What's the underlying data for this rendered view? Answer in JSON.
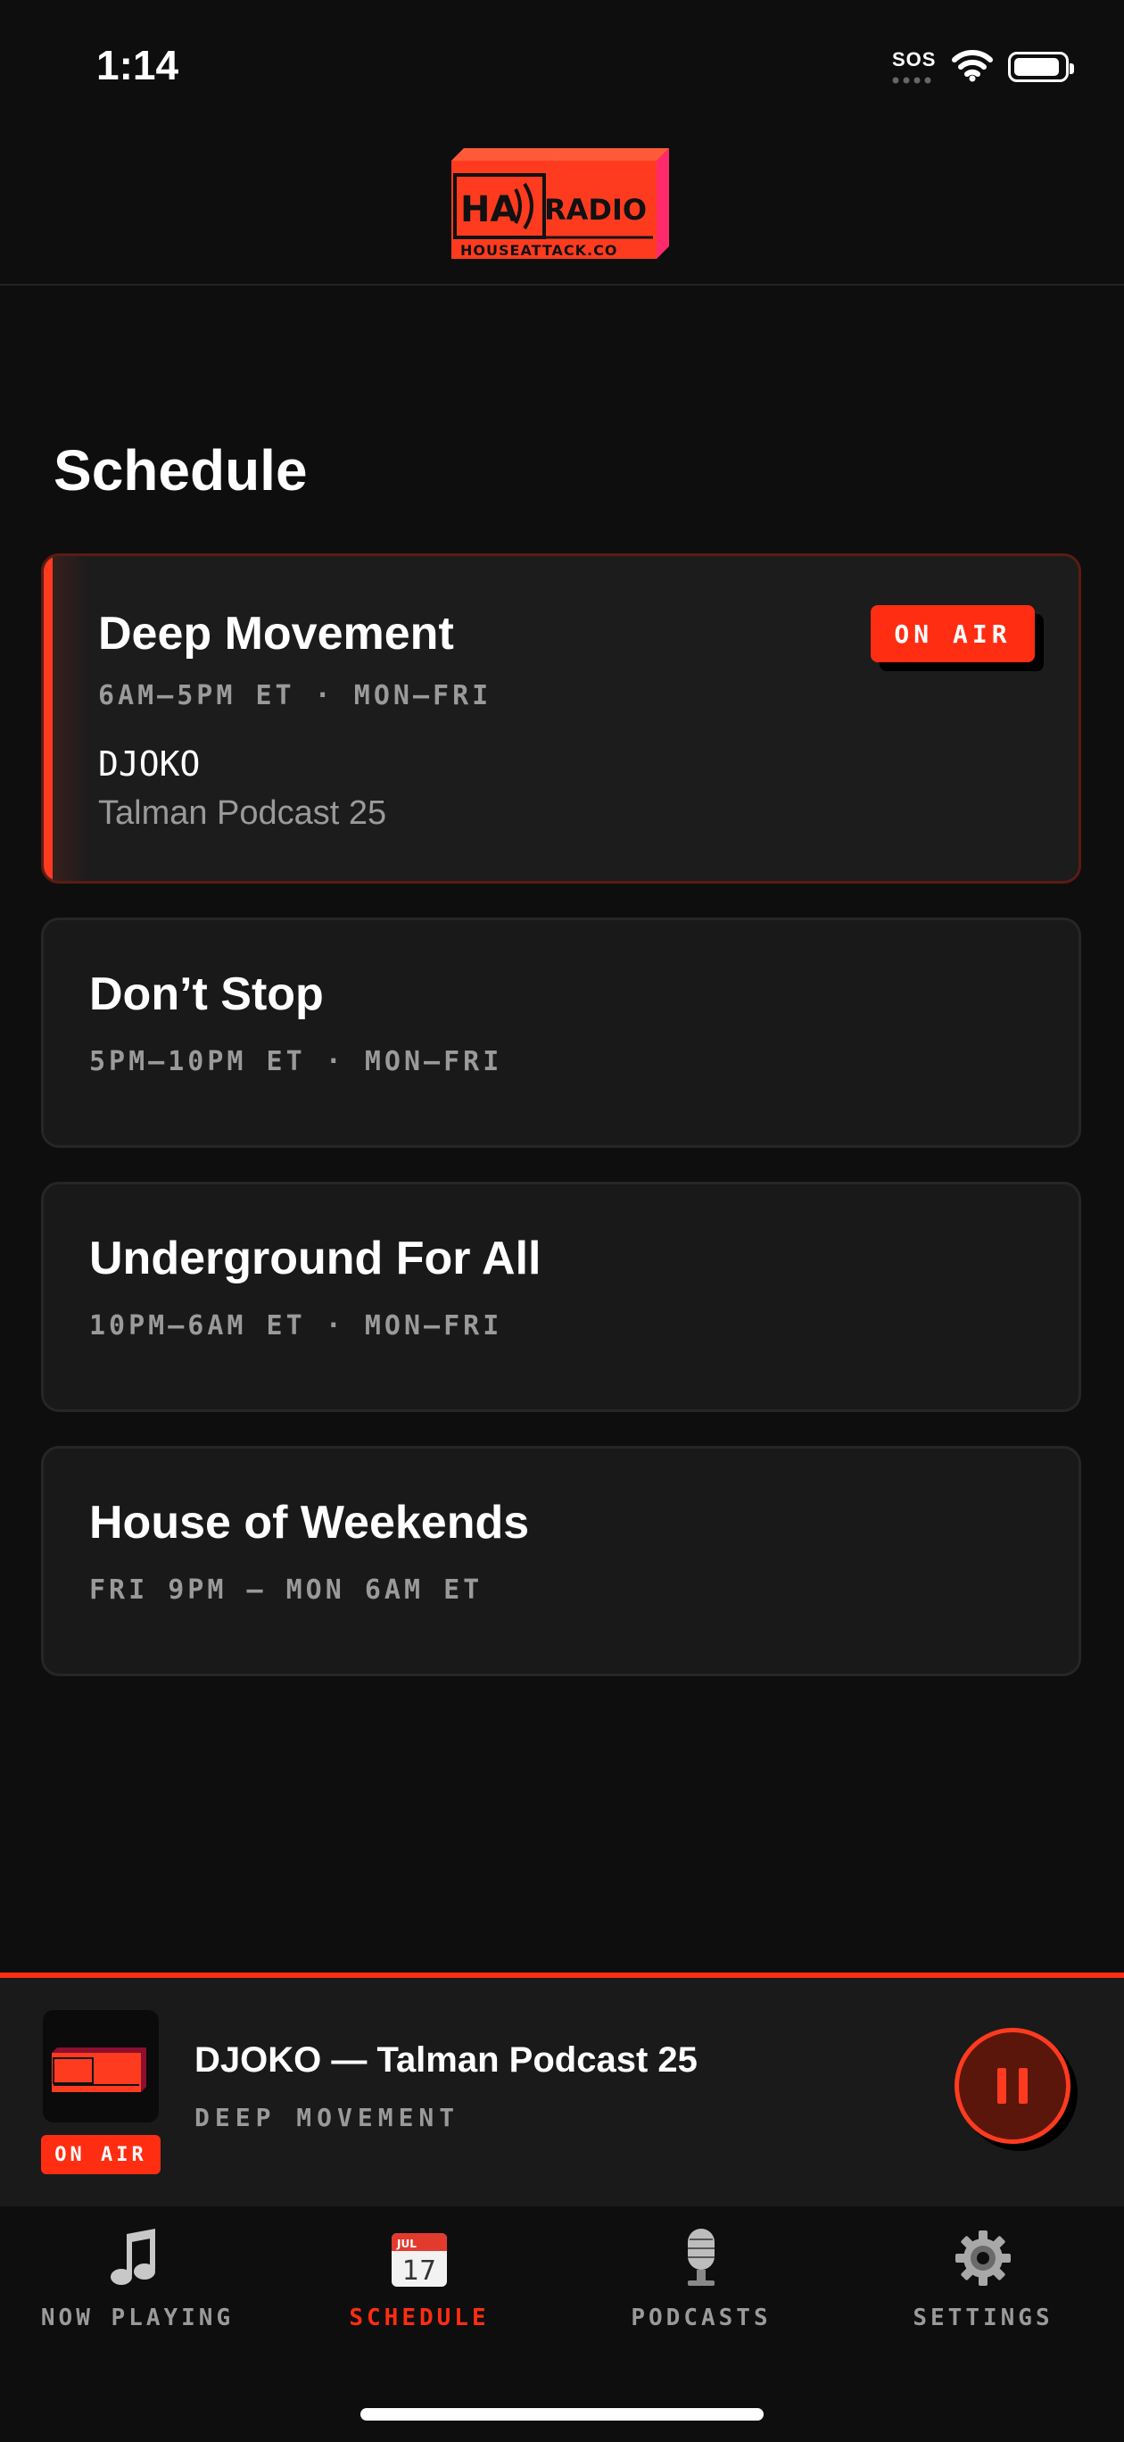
{
  "status_bar": {
    "time": "1:14",
    "sos": "SOS"
  },
  "header": {
    "logo_word": "RADIO",
    "logo_sub": "HOUSEATTACK.CO",
    "logo_mark": "HA"
  },
  "page": {
    "title": "Schedule"
  },
  "schedule": [
    {
      "title": "Deep Movement",
      "time": "6AM–5PM ET · MON–FRI",
      "dj": "DJOKO",
      "track": "Talman Podcast 25",
      "badge": "ON AIR"
    },
    {
      "title": "Don’t Stop",
      "time": "5PM–10PM ET · MON–FRI"
    },
    {
      "title": "Underground For All",
      "time": "10PM–6AM ET · MON–FRI"
    },
    {
      "title": "House of Weekends",
      "time": "FRI 9PM – MON 6AM ET"
    }
  ],
  "player": {
    "title": "DJOKO — Talman Podcast 25",
    "show": "DEEP MOVEMENT",
    "badge": "ON AIR",
    "state": "playing"
  },
  "tabs": [
    {
      "label": "NOW PLAYING",
      "icon": "music-note-icon"
    },
    {
      "label": "SCHEDULE",
      "icon": "calendar-icon",
      "active": true,
      "calendar_month": "JUL",
      "calendar_day": "17"
    },
    {
      "label": "PODCASTS",
      "icon": "microphone-icon"
    },
    {
      "label": "SETTINGS",
      "icon": "gear-icon"
    }
  ],
  "colors": {
    "accent": "#ff2d12",
    "background": "#0e0e0e",
    "card": "#191919",
    "muted": "#9a9a9a"
  }
}
